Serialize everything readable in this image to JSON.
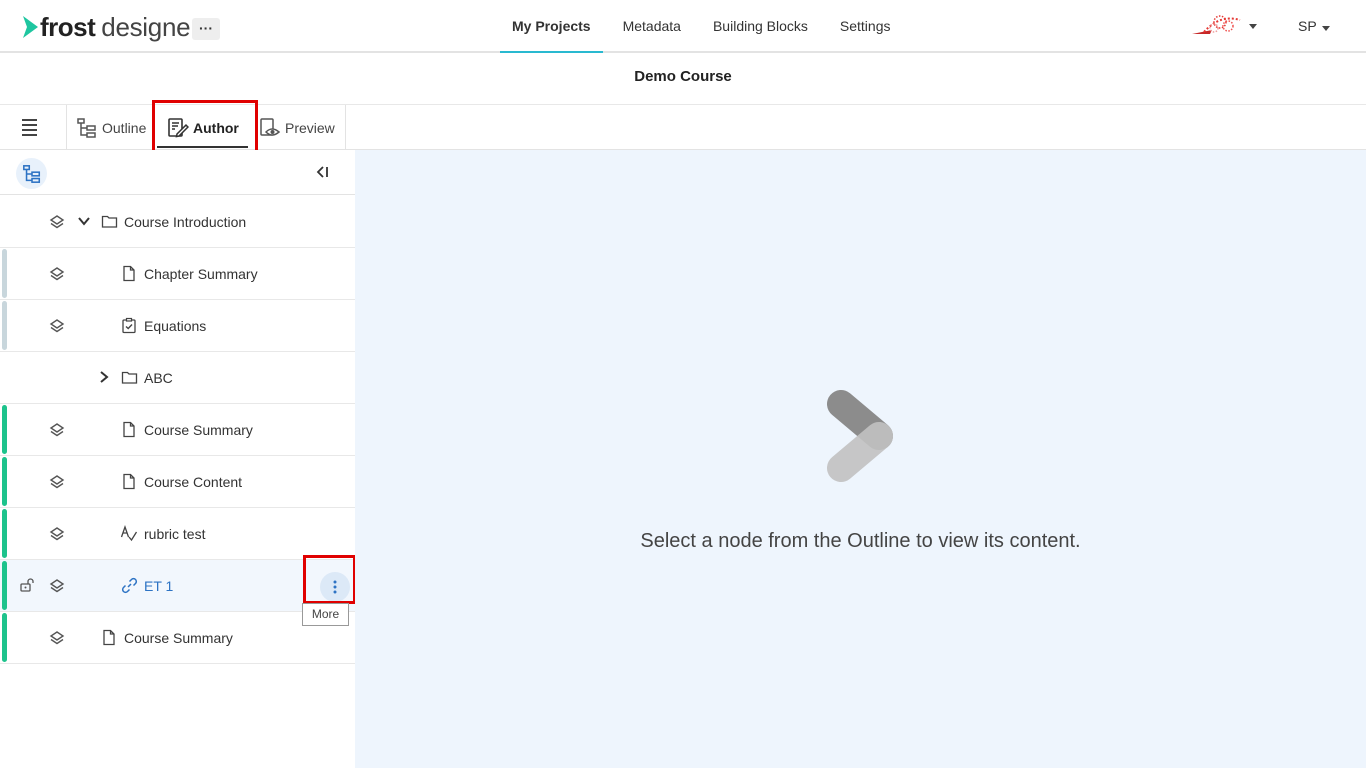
{
  "header": {
    "logo_bold": "frost",
    "logo_light": "designer",
    "more_label": "···",
    "nav": [
      "My Projects",
      "Metadata",
      "Building Blocks",
      "Settings"
    ],
    "active_nav": "My Projects",
    "user_initials": "SP"
  },
  "course": {
    "title": "Demo Course"
  },
  "tabs": {
    "outline": "Outline",
    "author": "Author",
    "preview": "Preview",
    "active": "Author"
  },
  "tree": [
    {
      "label": "Course Introduction",
      "type": "folder",
      "expanded": true,
      "indent": 0,
      "bar": "none"
    },
    {
      "label": "Chapter Summary",
      "type": "page",
      "indent": 1,
      "bar": "grey"
    },
    {
      "label": "Equations",
      "type": "assessment",
      "indent": 1,
      "bar": "grey"
    },
    {
      "label": "ABC",
      "type": "folder",
      "expanded": false,
      "indent": 1,
      "bar": "none"
    },
    {
      "label": "Course Summary",
      "type": "page",
      "indent": 1,
      "bar": "green"
    },
    {
      "label": "Course Content",
      "type": "page",
      "indent": 1,
      "bar": "green"
    },
    {
      "label": "rubric test",
      "type": "rubric",
      "indent": 1,
      "bar": "green"
    },
    {
      "label": "ET 1",
      "type": "link",
      "indent": 1,
      "bar": "green",
      "selected": true,
      "locked": true
    },
    {
      "label": "Course Summary",
      "type": "page",
      "indent": 0,
      "bar": "green"
    }
  ],
  "tooltip": {
    "text": "More"
  },
  "main": {
    "empty_message": "Select a node from the Outline to view its content."
  },
  "colors": {
    "accent": "#29b9d0",
    "green_bar": "#1dc38c",
    "grey_bar": "#c8d6dc",
    "highlight": "#e00000",
    "link": "#2d73c4"
  },
  "icons": [
    "frost-chevron-logo",
    "hamburger-icon",
    "outline-tree-icon",
    "author-edit-icon",
    "preview-eye-icon",
    "collapse-panel-icon",
    "layers-icon",
    "folder-icon",
    "page-icon",
    "checklist-icon",
    "rubric-icon",
    "link-icon",
    "lock-open-icon",
    "kebab-icon",
    "chevron-down-icon",
    "chevron-right-icon"
  ]
}
